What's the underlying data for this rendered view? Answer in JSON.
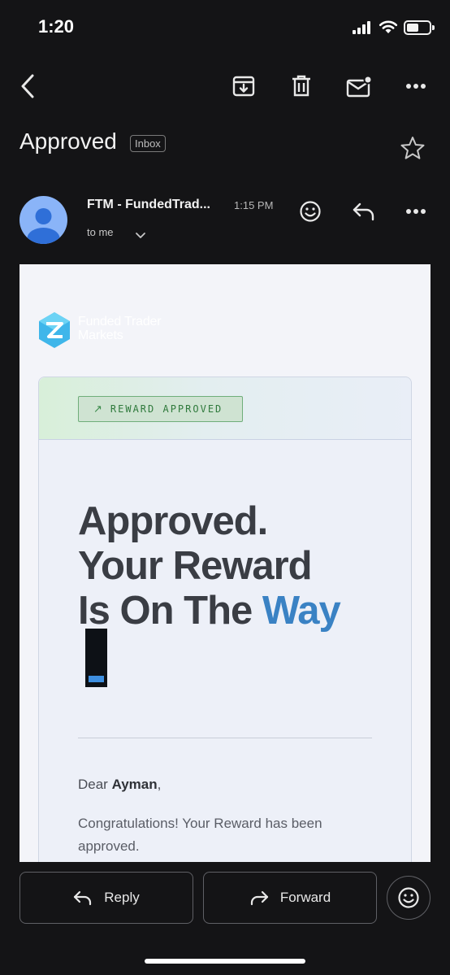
{
  "status_bar": {
    "time": "1:20"
  },
  "toolbar": {
    "back": "back-icon",
    "archive": "archive-icon",
    "delete": "trash-icon",
    "mark_unread": "mail-unread-icon",
    "more": "more-icon"
  },
  "email": {
    "subject": "Approved",
    "label": "Inbox",
    "sender": "FTM - FundedTrad...",
    "time": "1:15 PM",
    "recipient": "to me"
  },
  "body": {
    "logo_text": "Funded Trader Markets",
    "badge": "REWARD APPROVED",
    "headline_line1": "Approved.",
    "headline_line2": "Your Reward",
    "headline_line3": "Is On The ",
    "headline_highlight": "Way",
    "greeting_prefix": "Dear ",
    "greeting_name": "Ayman",
    "greeting_suffix": ",",
    "message": "Congratulations! Your Reward has been approved."
  },
  "actions": {
    "reply": "Reply",
    "forward": "Forward"
  },
  "colors": {
    "background": "#141416",
    "accent_blue": "#3a82c4",
    "badge_green": "#2f7a3c",
    "avatar": "#8ab4f8"
  }
}
